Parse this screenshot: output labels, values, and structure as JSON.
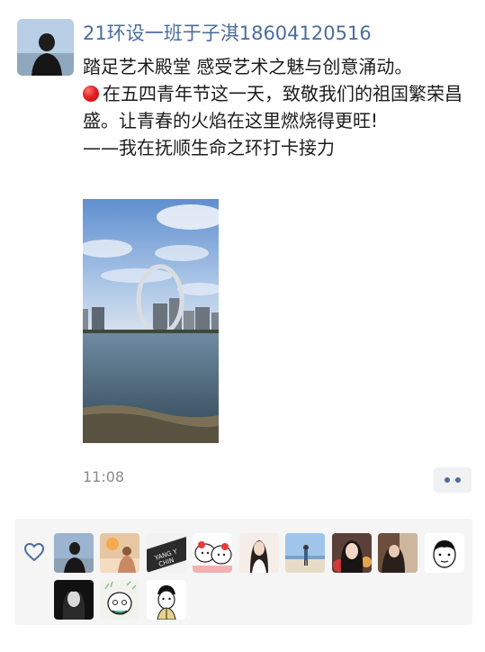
{
  "post": {
    "author": "21环设一班于子淇18604120516",
    "line1": "踏足艺术殿堂 感受艺术之魅与创意涌动。",
    "line2": "在五四青年节这一天，致敬我们的祖国繁荣昌盛。让青春的火焰在这里燃烧得更旺!",
    "line3": "——我在抚顺生命之环打卡接力",
    "time": "11:08",
    "emoji_icon": "red-circle-icon",
    "photo_subject": "Shenyang-Fushun Ring of Life landmark over a lake"
  },
  "likes": {
    "icon": "heart-icon",
    "avatars": [
      {
        "name": "liker-avatar-1",
        "bg": "#9bb4cf"
      },
      {
        "name": "liker-avatar-2",
        "bg": "#e7c7a3"
      },
      {
        "name": "liker-avatar-3",
        "bg": "#2b2b2b"
      },
      {
        "name": "liker-avatar-4",
        "bg": "#ffffff"
      },
      {
        "name": "liker-avatar-5",
        "bg": "#f4ede8"
      },
      {
        "name": "liker-avatar-6",
        "bg": "#9fc6ea"
      },
      {
        "name": "liker-avatar-7",
        "bg": "#5b4038"
      },
      {
        "name": "liker-avatar-8",
        "bg": "#6b4e3c"
      },
      {
        "name": "liker-avatar-9",
        "bg": "#ffffff"
      },
      {
        "name": "liker-avatar-10",
        "bg": "#111111"
      },
      {
        "name": "liker-avatar-11",
        "bg": "#f3f3ee"
      },
      {
        "name": "liker-avatar-12",
        "bg": "#ffffff"
      }
    ]
  },
  "colors": {
    "name_link": "#4b6d9c",
    "time": "#8a8a8a",
    "likes_bg": "#f5f5f5"
  }
}
